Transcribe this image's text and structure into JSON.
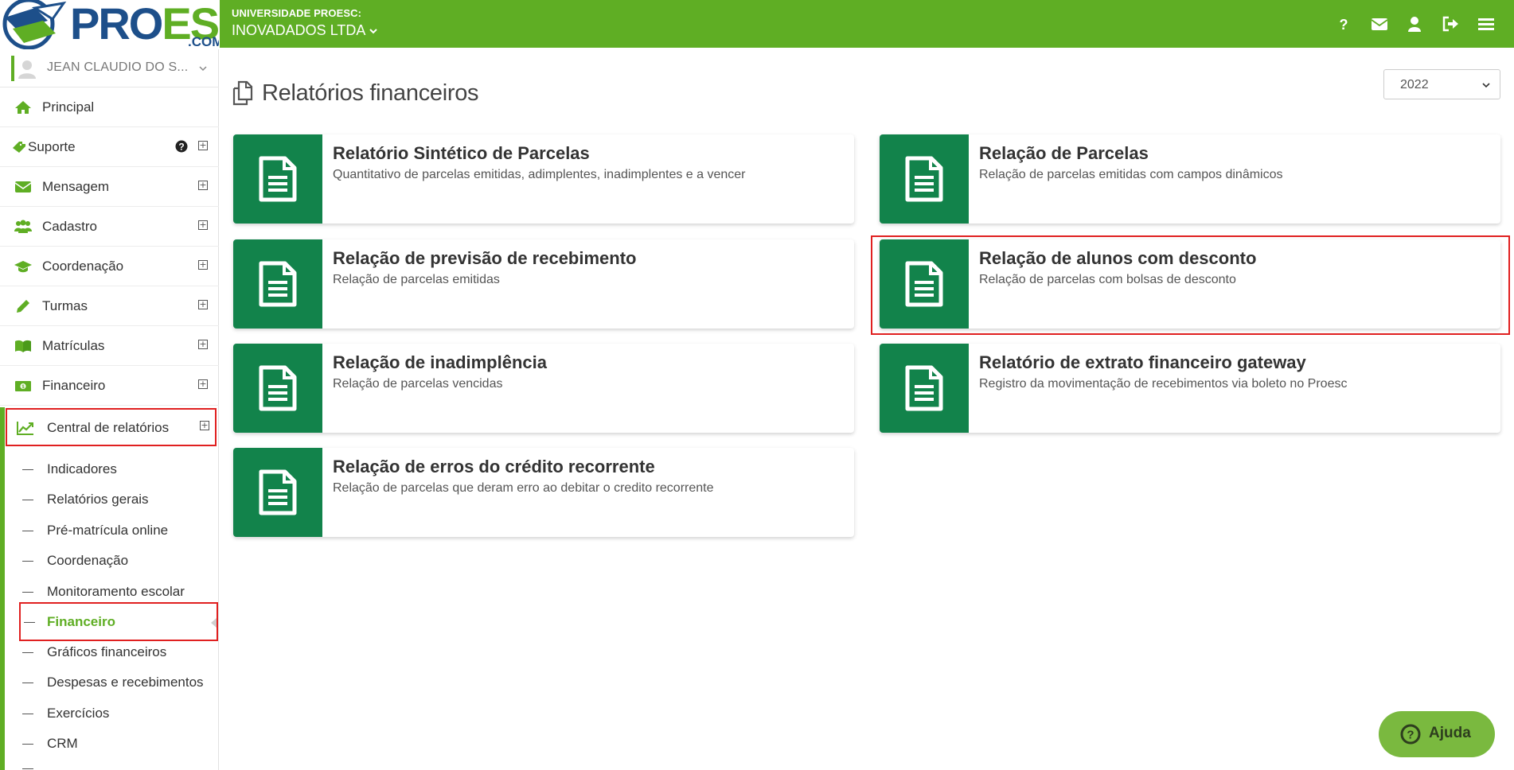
{
  "logo": {
    "pro": "PRO",
    "esc": "ESC",
    "com": ".COM"
  },
  "user": {
    "name": "JEAN CLAUDIO DO S..."
  },
  "sidebar": {
    "items": [
      {
        "label": "Principal",
        "icon": "home-icon"
      },
      {
        "label": "Suporte",
        "icon": "ticket-icon"
      },
      {
        "label": "Mensagem",
        "icon": "envelope-icon"
      },
      {
        "label": "Cadastro",
        "icon": "users-icon"
      },
      {
        "label": "Coordenação",
        "icon": "graduation-cap-icon"
      },
      {
        "label": "Turmas",
        "icon": "pencil-icon"
      },
      {
        "label": "Matrículas",
        "icon": "book-icon"
      },
      {
        "label": "Financeiro",
        "icon": "money-icon"
      },
      {
        "label": "Central de relatórios",
        "icon": "line-chart-icon"
      }
    ],
    "subitems": [
      "Indicadores",
      "Relatórios gerais",
      "Pré-matrícula online",
      "Coordenação",
      "Monitoramento escolar",
      "Financeiro",
      "Gráficos financeiros",
      "Despesas e recebimentos",
      "Exercícios",
      "CRM"
    ],
    "active_subitem": "Financeiro"
  },
  "header": {
    "org": "UNIVERSIDADE PROESC:",
    "company": "INOVADADOS LTDA",
    "icons": [
      "question-icon",
      "envelope-icon",
      "user-icon",
      "sign-out-icon",
      "menu-icon"
    ]
  },
  "main": {
    "title": "Relatórios financeiros",
    "year": "2022",
    "cards": [
      {
        "title": "Relatório Sintético de Parcelas",
        "desc": "Quantitativo de parcelas emitidas, adimplentes, inadimplentes e a vencer"
      },
      {
        "title": "Relação de Parcelas",
        "desc": "Relação de parcelas emitidas com campos dinâmicos"
      },
      {
        "title": "Relação de previsão de recebimento",
        "desc": "Relação de parcelas emitidas"
      },
      {
        "title": "Relação de alunos com desconto",
        "desc": "Relação de parcelas com bolsas de desconto"
      },
      {
        "title": "Relação de inadimplência",
        "desc": "Relação de parcelas vencidas"
      },
      {
        "title": "Relatório de extrato financeiro gateway",
        "desc": "Registro da movimentação de recebimentos via boleto no Proesc"
      },
      {
        "title": "Relação de erros do crédito recorrente",
        "desc": "Relação de parcelas que deram erro ao debitar o credito recorrente"
      }
    ]
  },
  "help": {
    "label": "Ajuda"
  },
  "colors": {
    "brand_green": "#5fae24",
    "card_green": "#12834b",
    "logo_blue": "#1d4f8a",
    "highlight_red": "#e02020"
  }
}
